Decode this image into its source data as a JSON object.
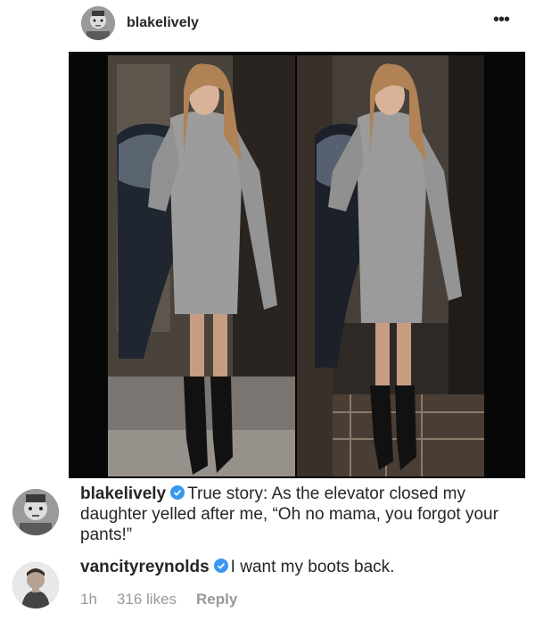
{
  "post": {
    "username": "blakelively",
    "more_icon": "more-horizontal-icon"
  },
  "comments": [
    {
      "username": "blakelively",
      "verified": true,
      "text": "True story: As the elevator closed my daughter yelled after me, “Oh no mama, you forgot your pants!”"
    },
    {
      "username": "vancityreynolds",
      "verified": true,
      "text": "I want my boots back.",
      "time": "1h",
      "likes": "316 likes",
      "reply_label": "Reply"
    }
  ],
  "colors": {
    "verified": "#3897f0",
    "meta_text": "#999999",
    "text": "#262626"
  }
}
